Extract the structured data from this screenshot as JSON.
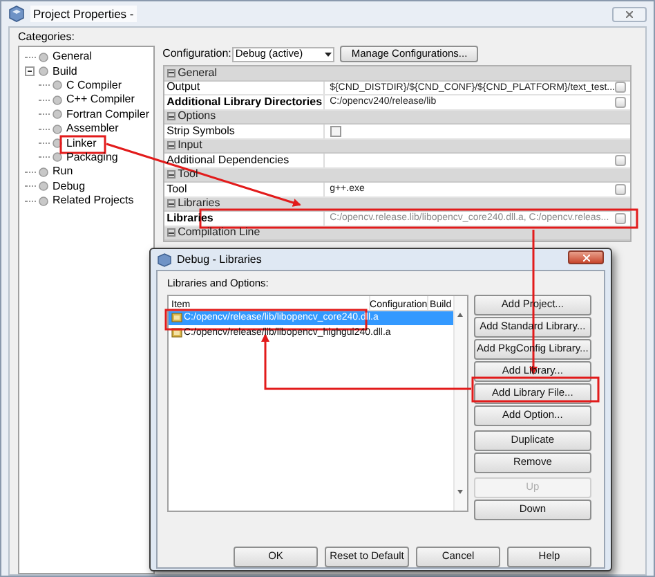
{
  "window": {
    "title": "Project Properties -"
  },
  "categories_label": "Categories:",
  "categories": [
    {
      "label": "General"
    },
    {
      "label": "Build",
      "expanded": true,
      "children": [
        {
          "label": "C Compiler"
        },
        {
          "label": "C++ Compiler"
        },
        {
          "label": "Fortran Compiler"
        },
        {
          "label": "Assembler"
        },
        {
          "label": "Linker"
        },
        {
          "label": "Packaging"
        }
      ]
    },
    {
      "label": "Run"
    },
    {
      "label": "Debug"
    },
    {
      "label": "Related Projects"
    }
  ],
  "configuration": {
    "label": "Configuration:",
    "value": "Debug (active)",
    "manage_button": "Manage Configurations..."
  },
  "properties": [
    {
      "kind": "section",
      "label": "General"
    },
    {
      "kind": "text",
      "label": "Output",
      "bold": false,
      "value": "${CND_DISTDIR}/${CND_CONF}/${CND_PLATFORM}/text_test..."
    },
    {
      "kind": "text",
      "label": "Additional Library Directories",
      "bold": true,
      "value": "C:/opencv240/release/lib"
    },
    {
      "kind": "section",
      "label": "Options"
    },
    {
      "kind": "checkbox",
      "label": "Strip Symbols",
      "bold": false,
      "checked": false
    },
    {
      "kind": "section",
      "label": "Input"
    },
    {
      "kind": "text",
      "label": "Additional Dependencies",
      "bold": false
    },
    {
      "kind": "section",
      "label": "Tool"
    },
    {
      "kind": "text",
      "label": "Tool",
      "bold": false,
      "value": "g++.exe"
    },
    {
      "kind": "section",
      "label": "Libraries"
    },
    {
      "kind": "text",
      "label": "Libraries",
      "bold": true,
      "value": "C:/opencv.release.lib/libopencv_core240.dll.a, C:/opencv.releas...",
      "muted": true
    },
    {
      "kind": "section",
      "label": "Compilation Line"
    }
  ],
  "dialog": {
    "title": "Debug - Libraries",
    "list_label": "Libraries and Options:",
    "columns": [
      "Item",
      "Configuration",
      "Build"
    ],
    "items": [
      {
        "text": "C:/opencv/release/lib/libopencv_core240.dll.a",
        "selected": true
      },
      {
        "text": "C:/opencv/release/lib/libopencv_highgui240.dll.a",
        "selected": false
      }
    ],
    "side_button_groups": [
      [
        {
          "label": "Add Project...",
          "disabled": false
        },
        {
          "label": "Add Standard Library...",
          "disabled": false
        },
        {
          "label": "Add PkgConfig Library...",
          "disabled": false
        },
        {
          "label": "Add Library...",
          "disabled": false
        },
        {
          "label": "Add Library File...",
          "disabled": false
        },
        {
          "label": "Add Option...",
          "disabled": false
        }
      ],
      [
        {
          "label": "Duplicate",
          "disabled": false
        },
        {
          "label": "Remove",
          "disabled": false
        }
      ],
      [
        {
          "label": "Up",
          "disabled": true
        },
        {
          "label": "Down",
          "disabled": false
        }
      ]
    ],
    "bottom_buttons": [
      "OK",
      "Reset to Default",
      "Cancel",
      "Help"
    ]
  }
}
